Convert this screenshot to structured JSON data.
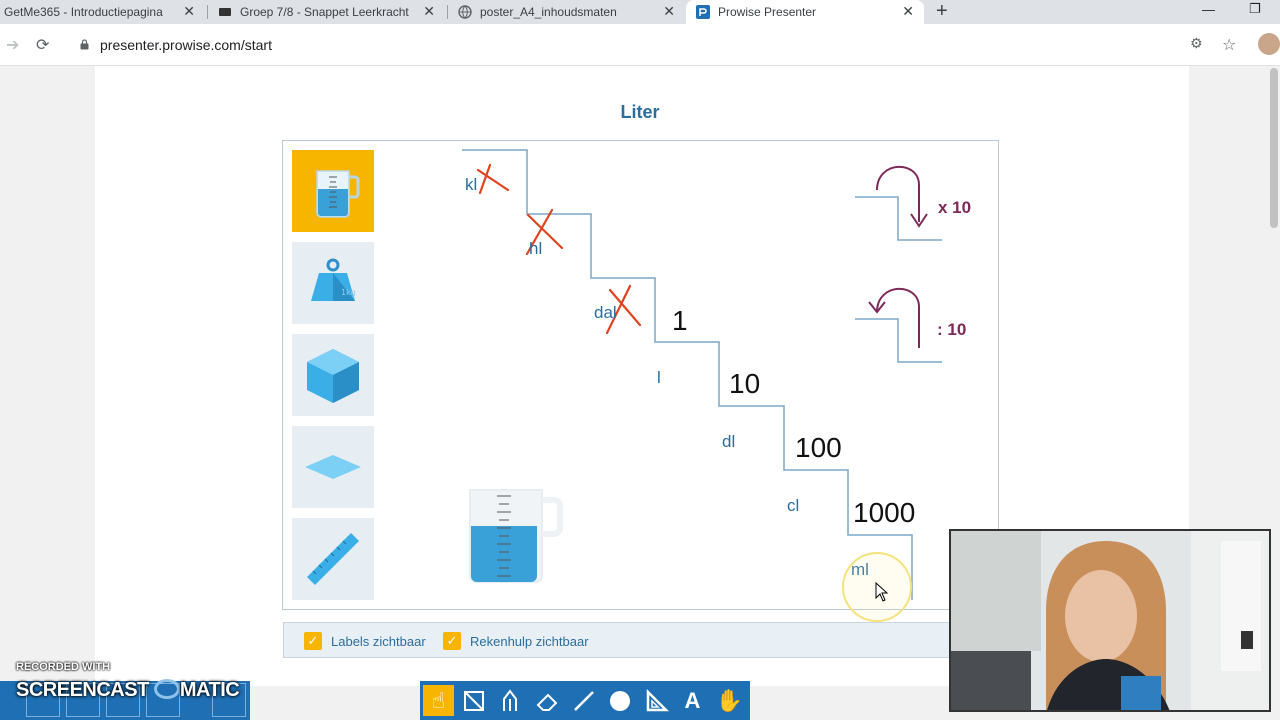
{
  "browser": {
    "tabs": [
      {
        "label": "GetMe365 - Introductiepagina",
        "close": "✕"
      },
      {
        "label": "Groep 7/8 - Snappet Leerkracht",
        "close": "✕"
      },
      {
        "label": "poster_A4_inhoudsmaten",
        "close": "✕"
      },
      {
        "label": "Prowise Presenter",
        "close": "✕"
      }
    ],
    "new_tab": "+",
    "url": "presenter.prowise.com/start"
  },
  "page": {
    "title": "Liter",
    "staircase": {
      "units": [
        "kl",
        "hl",
        "dal",
        "l",
        "dl",
        "cl",
        "ml"
      ],
      "numbers": [
        "1",
        "10",
        "100",
        "1000"
      ],
      "multiply_label": "x 10",
      "divide_label": ": 10"
    },
    "tools": [
      "measuring-jug-icon",
      "weight-icon",
      "cube-icon",
      "square-icon",
      "ruler-icon"
    ],
    "bottom": {
      "labels_visible": "Labels zichtbaar",
      "calc_help_visible": "Rekenhulp zichtbaar"
    }
  },
  "recording": {
    "small": "RECORDED WITH",
    "big": "SCREENCAST",
    "big_tail": "MATIC"
  },
  "colors": {
    "accent": "#f7b500",
    "unit_blue": "#2a6e9e",
    "op_purple": "#7d2a5a",
    "cross_red": "#e0431e",
    "toolbar_blue": "#1e6fb3"
  }
}
